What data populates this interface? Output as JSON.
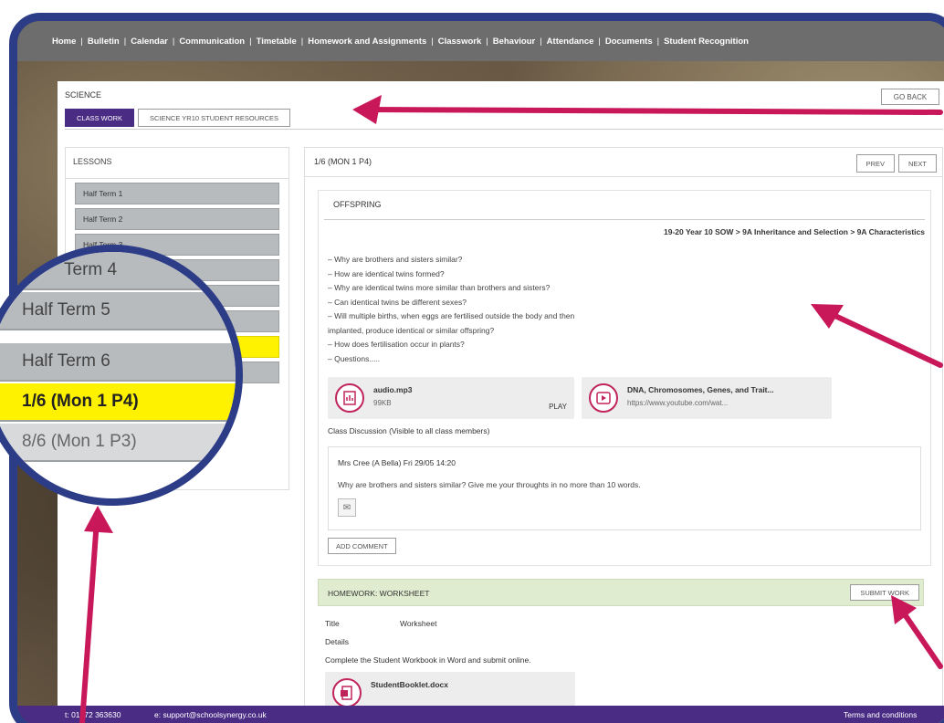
{
  "topnav": {
    "items": [
      "Home",
      "Bulletin",
      "Calendar",
      "Communication",
      "Timetable",
      "Homework and Assignments",
      "Classwork",
      "Behaviour",
      "Attendance",
      "Documents",
      "Student Recognition"
    ]
  },
  "page": {
    "title": "SCIENCE",
    "go_back": "GO BACK",
    "tabs": [
      "CLASS WORK",
      "SCIENCE YR10 STUDENT RESOURCES"
    ]
  },
  "lessons": {
    "heading": "LESSONS",
    "items": [
      "Half Term 1",
      "Half Term 2",
      "Half Term 3",
      "Half Term 4",
      "Half Term 5",
      "Half Term 6",
      "1/6 (Mon 1 P4)",
      "8/6 (Mon 1 P3)"
    ]
  },
  "zoom": {
    "items": [
      "Term 4",
      "Half Term 5",
      "Half Term 6",
      "1/6 (Mon 1 P4)",
      "8/6 (Mon 1 P3)"
    ]
  },
  "lesson": {
    "breadcrumb": "1/6 (MON 1 P4)",
    "prev": "PREV",
    "next": "NEXT",
    "title": "OFFSPRING",
    "path": "19-20 Year 10 SOW > 9A Inheritance and Selection > 9A Characteristics",
    "questions": [
      "– Why are brothers and sisters similar?",
      "– How are identical twins formed?",
      "– Why are identical twins more similar than brothers and sisters?",
      "– Can identical twins be different sexes?",
      "– Will multiple births, when eggs are fertilised outside the body and then",
      "implanted, produce identical or similar offspring?",
      "– How does fertilisation occur in plants?",
      "– Questions....."
    ],
    "attachments": {
      "audio": {
        "name": "audio.mp3",
        "size": "99KB",
        "action": "PLAY"
      },
      "video": {
        "name": "DNA, Chromosomes, Genes, and Trait...",
        "url": "https://www.youtube.com/wat..."
      }
    },
    "discussion": {
      "label": "Class Discussion (Visible to all class members)",
      "author": "Mrs Cree (A Bella) Fri 29/05 14:20",
      "text": "Why are brothers and sisters similar? Give me your throughts in no more than 10 words.",
      "add_comment": "ADD COMMENT"
    }
  },
  "homework": {
    "heading": "HOMEWORK: WORKSHEET",
    "submit": "SUBMIT WORK",
    "title_label": "Title",
    "title_value": "Worksheet",
    "details_label": "Details",
    "details_text": "Complete the Student Workbook in Word and submit online.",
    "file": "StudentBooklet.docx"
  },
  "footer": {
    "phone": "t: 01272 363630",
    "email": "e: support@schoolsynergy.co.uk",
    "terms": "Terms and conditions"
  },
  "colors": {
    "frame": "#2c3c86",
    "accent_purple": "#4a2c84",
    "highlight": "#fff200",
    "arrow": "#c8185a"
  }
}
